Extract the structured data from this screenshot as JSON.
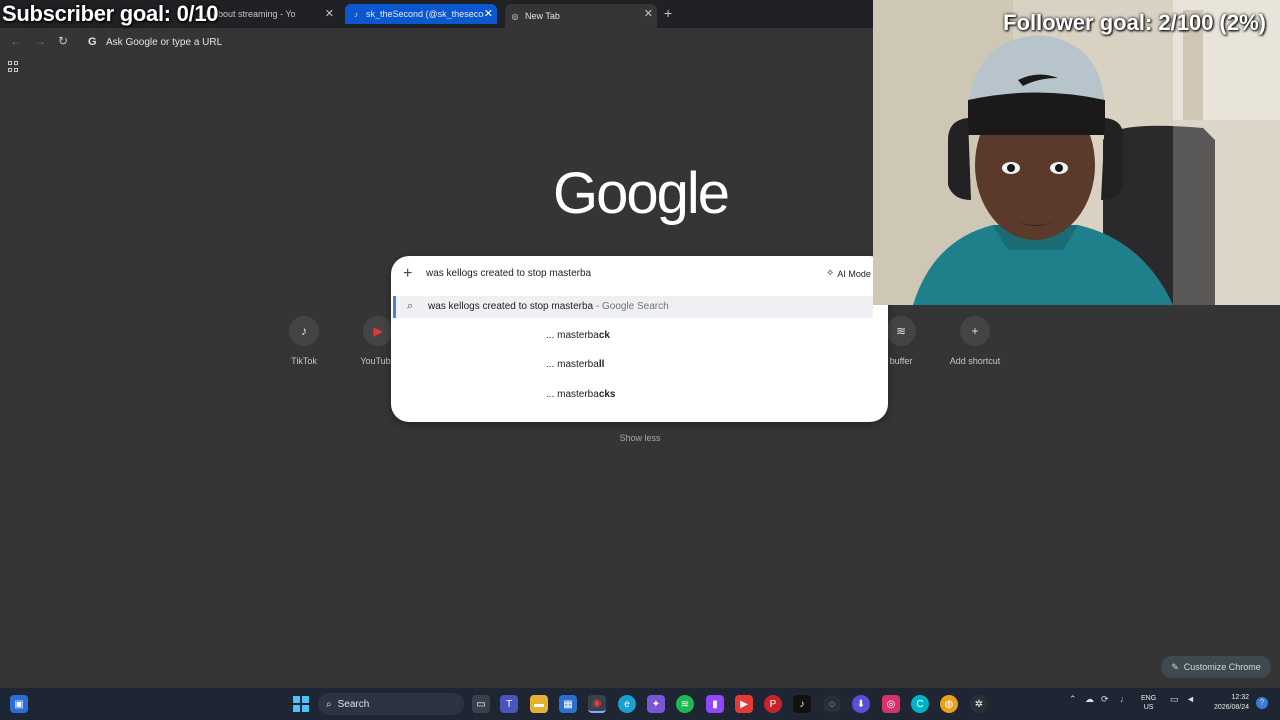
{
  "overlay": {
    "subscriber_goal": "Subscriber goal: 0/10",
    "follower_goal": "Follower goal: 2/100 (2%)"
  },
  "tabs": [
    {
      "title": "",
      "icon": "tiktok-icon"
    },
    {
      "title": "...a about streaming - Yo",
      "icon": "youtube-icon"
    },
    {
      "title": "sk_theSecond (@sk_thesecond)",
      "icon": "tiktok-icon"
    },
    {
      "title": "New Tab",
      "icon": "chrome-icon"
    }
  ],
  "toolbar": {
    "omnibox_placeholder": "Ask Google or type a URL"
  },
  "logo": "Google",
  "search": {
    "query": "was kellogs created to stop masterba",
    "ai_mode_label": "AI Mode",
    "primary_suggestion": "was kellogs created to stop masterba",
    "primary_suffix": " - Google Search",
    "completions": [
      {
        "prefix": "... masterba",
        "suffix": "ck"
      },
      {
        "prefix": "... masterba",
        "suffix": "ll"
      },
      {
        "prefix": "... masterba",
        "suffix": "cks"
      }
    ]
  },
  "shortcuts": [
    {
      "label": "TikTok",
      "icon": "tiktok-icon"
    },
    {
      "label": "YouTube",
      "icon": "youtube-icon"
    },
    {
      "label": "buffer",
      "icon": "buffer-icon"
    },
    {
      "label": "Add shortcut",
      "icon": "plus-icon"
    }
  ],
  "show_less": "Show less",
  "customize_label": "Customize Chrome",
  "taskbar": {
    "search_label": "Search",
    "lang_line1": "ENG",
    "lang_line2": "US",
    "time": "12:32",
    "date": "2026/08/24"
  },
  "colors": {
    "page_bg": "#353535",
    "tab_active": "#0b57d0",
    "taskbar_bg": "#1f2633",
    "suggest_highlight": "#4a7fd8"
  }
}
